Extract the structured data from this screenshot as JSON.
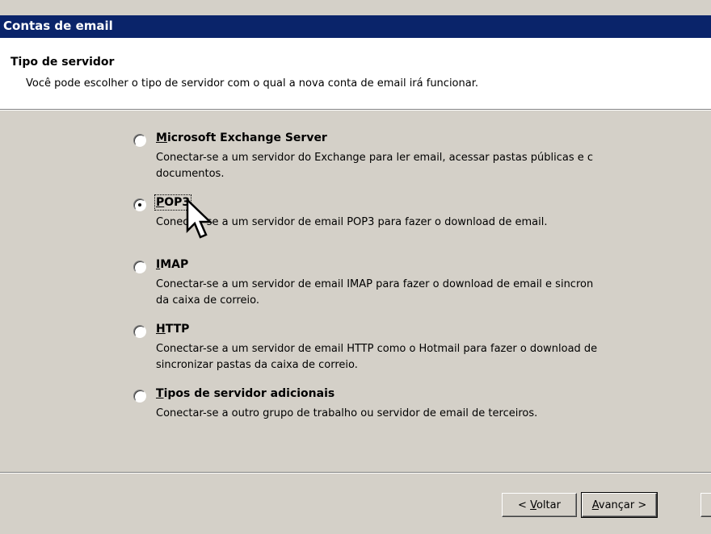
{
  "window": {
    "title": "Contas de email"
  },
  "header": {
    "title": "Tipo de servidor",
    "subtitle": "Você pode escolher o tipo de servidor com o qual a nova conta de email irá funcionar."
  },
  "options": [
    {
      "label_mnemonic": "M",
      "label_rest": "icrosoft Exchange Server",
      "desc_line1": "Conectar-se a um servidor do Exchange para ler email, acessar pastas públicas e c",
      "desc_line2": "documentos.",
      "selected": false
    },
    {
      "label_mnemonic": "P",
      "label_rest": "OP3",
      "desc_line1": "Conectar-se a um servidor de email POP3 para fazer o download de email.",
      "desc_line2": "",
      "selected": true
    },
    {
      "label_mnemonic": "I",
      "label_rest": "MAP",
      "desc_line1": "Conectar-se a um servidor de email IMAP para fazer o download de email e sincron",
      "desc_line2": "da caixa de correio.",
      "selected": false
    },
    {
      "label_mnemonic": "H",
      "label_rest": "TTP",
      "desc_line1": "Conectar-se a um servidor de email HTTP como o Hotmail para fazer o download de",
      "desc_line2": "sincronizar pastas da caixa de correio.",
      "selected": false
    },
    {
      "label_mnemonic": "T",
      "label_rest": "ipos de servidor adicionais",
      "desc_line1": "Conectar-se a outro grupo de trabalho ou servidor de email de terceiros.",
      "desc_line2": "",
      "selected": false
    }
  ],
  "buttons": {
    "back_prefix": "< ",
    "back_mnemonic": "V",
    "back_rest": "oltar",
    "next_mnemonic": "A",
    "next_rest": "vançar >"
  },
  "icons": {
    "cursor": "mouse-pointer-icon",
    "radio": "radio-button-icon"
  },
  "colors": {
    "titlebar": "#0a246a",
    "dialog_face": "#d4d0c8",
    "header_bg": "#ffffff"
  }
}
